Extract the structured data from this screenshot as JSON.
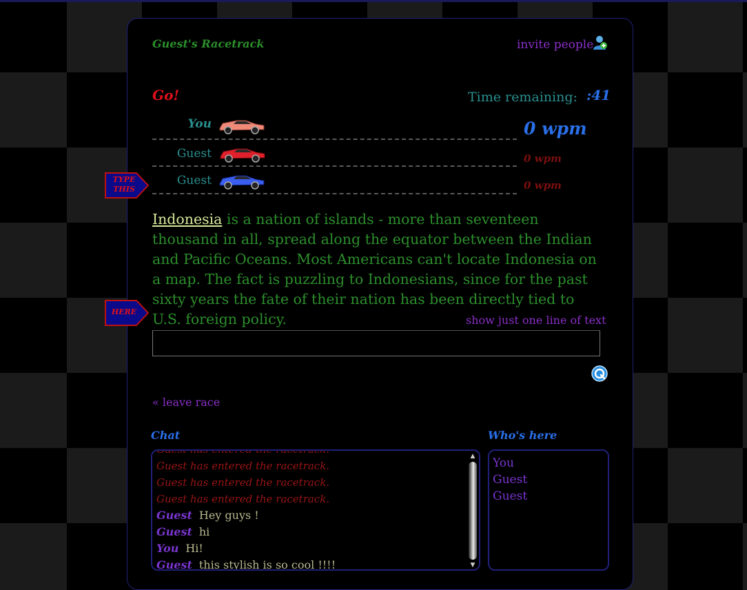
{
  "header": {
    "track_title": "Guest's Racetrack",
    "invite_label": "invite people"
  },
  "race": {
    "status": "Go!",
    "time_label": "Time remaining:",
    "time_value": ":41",
    "lanes": [
      {
        "name": "You",
        "wpm": "0 wpm",
        "car_color": "#f08a78"
      },
      {
        "name": "Guest",
        "wpm": "0 wpm",
        "car_color": "#e0202a"
      },
      {
        "name": "Guest",
        "wpm": "0 wpm",
        "car_color": "#3a5ef0"
      }
    ]
  },
  "flags": {
    "type_this": [
      "TYPE",
      "THIS"
    ],
    "here": "HERE"
  },
  "passage": {
    "current_word": "Indonesia",
    "rest": " is a nation of islands - more than seventeen thousand in all, spread along the equator between the Indian and Pacific Oceans. Most Americans can't locate Indonesia on a map. The fact is puzzling to Indonesians, since for the past sixty years the fate of their nation has been directly tied to U.S. foreign policy."
  },
  "controls": {
    "one_line_label": "show just one line of text",
    "typing_value": "",
    "leave_label": "« leave race"
  },
  "chat": {
    "heading": "Chat",
    "lines": [
      {
        "type": "system",
        "text": "Guest has entered the racetrack."
      },
      {
        "type": "system",
        "text": "Guest has entered the racetrack."
      },
      {
        "type": "system",
        "text": "Guest has entered the racetrack."
      },
      {
        "type": "system",
        "text": "Guest has entered the racetrack."
      },
      {
        "type": "msg",
        "who": "Guest",
        "text": "Hey guys !"
      },
      {
        "type": "msg",
        "who": "Guest",
        "text": "hi"
      },
      {
        "type": "msg",
        "who": "You",
        "text": "Hi!"
      },
      {
        "type": "msg",
        "who": "Guest",
        "text": "this stylish is so cool !!!!"
      }
    ]
  },
  "who": {
    "heading": "Who's here",
    "people": [
      "You",
      "Guest",
      "Guest"
    ]
  },
  "colors": {
    "accent_blue": "#2a6fe8",
    "link_purple": "#8a30c8",
    "alert_red": "#e0101a",
    "text_green": "#2c8f2c"
  }
}
